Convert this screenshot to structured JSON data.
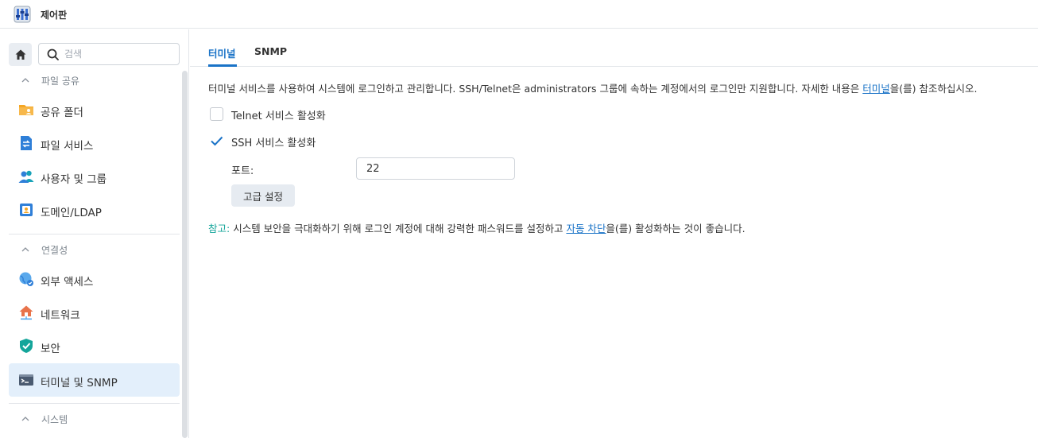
{
  "app": {
    "title": "제어판"
  },
  "sidebar": {
    "search_placeholder": "검색",
    "sections": [
      {
        "header": "파일 공유",
        "items": [
          {
            "label": "공유 폴더",
            "icon": "folder-share-icon"
          },
          {
            "label": "파일 서비스",
            "icon": "file-services-icon"
          },
          {
            "label": "사용자 및 그룹",
            "icon": "users-group-icon"
          },
          {
            "label": "도메인/LDAP",
            "icon": "domain-ldap-icon"
          }
        ]
      },
      {
        "header": "연결성",
        "items": [
          {
            "label": "외부 액세스",
            "icon": "external-access-icon"
          },
          {
            "label": "네트워크",
            "icon": "network-icon"
          },
          {
            "label": "보안",
            "icon": "security-shield-icon"
          },
          {
            "label": "터미널 및 SNMP",
            "icon": "terminal-icon",
            "active": true
          }
        ]
      },
      {
        "header": "시스템",
        "items": []
      }
    ]
  },
  "main": {
    "tabs": [
      {
        "label": "터미널",
        "active": true
      },
      {
        "label": "SNMP",
        "active": false
      }
    ],
    "description": {
      "before": "터미널 서비스를 사용하여 시스템에 로그인하고 관리합니다. SSH/Telnet은 administrators 그룹에 속하는 계정에서의 로그인만 지원합니다. 자세한 내용은 ",
      "link": "터미널",
      "after": "을(를) 참조하십시오."
    },
    "telnet": {
      "label": "Telnet 서비스 활성화",
      "checked": false
    },
    "ssh": {
      "label": "SSH 서비스 활성화",
      "checked": true
    },
    "port": {
      "label": "포트:",
      "value": "22"
    },
    "advanced_button": "고급 설정",
    "note": {
      "prefix": "참고:",
      "before": " 시스템 보안을 극대화하기 위해 로그인 계정에 대해 강력한 패스워드를 설정하고 ",
      "link": "자동 차단",
      "after": "을(를) 활성화하는 것이 좋습니다."
    }
  },
  "colors": {
    "accent": "#1a73c7",
    "note": "#14a59a",
    "active_bg": "#e3effb"
  }
}
